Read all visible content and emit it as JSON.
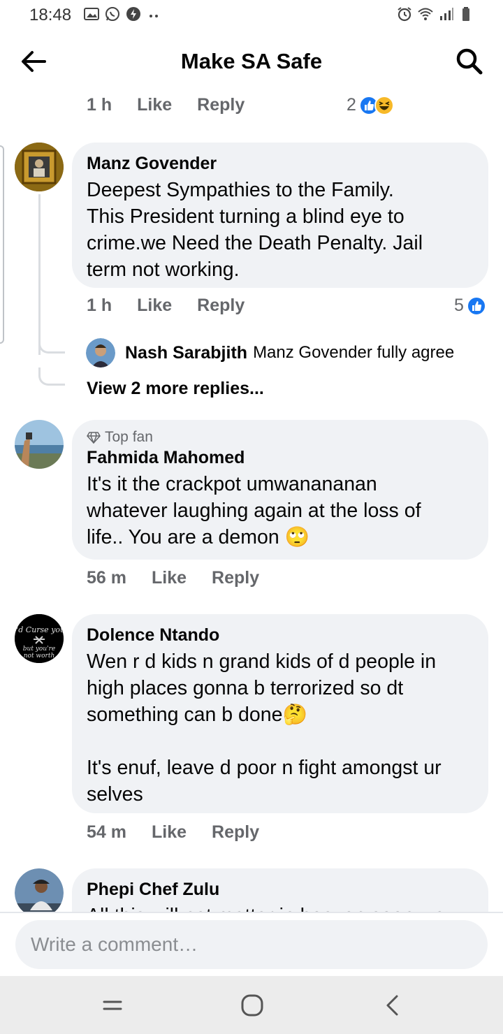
{
  "status_bar": {
    "time": "18:48",
    "left_icons": [
      "gallery-icon",
      "whatsapp-icon",
      "power-saving-icon",
      "more-dots-icon"
    ],
    "right_icons": [
      "alarm-icon",
      "wifi-icon",
      "signal-icon",
      "battery-icon"
    ]
  },
  "header": {
    "title": "Make SA Safe",
    "back_icon": "arrow-left-icon",
    "search_icon": "search-icon"
  },
  "top_meta": {
    "time": "1 h",
    "like": "Like",
    "reply": "Reply",
    "reaction_count": "2",
    "reactions": [
      "like",
      "haha"
    ]
  },
  "comments": [
    {
      "author": "Manz Govender",
      "text": "Deepest Sympathies to the Family.\nThis President turning a blind eye to\ncrime.we Need the Death Penalty. Jail\nterm not working.",
      "time": "1 h",
      "like": "Like",
      "reply": "Reply",
      "reaction_count": "5",
      "reactions": [
        "like"
      ],
      "reply_preview": {
        "author": "Nash Sarabjith",
        "text": "Manz Govender fully agree"
      },
      "view_more": "View 2 more replies..."
    },
    {
      "badge": "Top fan",
      "author": "Fahmida Mahomed",
      "text": "It's it the crackpot umwanananan\nwhatever laughing again at the loss of\nlife.. You are a demon",
      "emoji": "🙄",
      "time": "56 m",
      "like": "Like",
      "reply": "Reply"
    },
    {
      "author": "Dolence Ntando",
      "text": "Wen r d kids n grand kids of d people in\nhigh places gonna b terrorized so dt\nsomething can b done",
      "emoji": "🤔",
      "text2": "It's enuf, leave d poor n fight amongst ur\nselves",
      "time": "54 m",
      "like": "Like",
      "reply": "Reply",
      "avatar_text": "I'd Curse you but you're not worth"
    },
    {
      "author": "Phepi Chef Zulu",
      "text": "All this will not matter in heaven soon we"
    }
  ],
  "compose": {
    "placeholder": "Write a comment…"
  },
  "nav_bar": {
    "icons": [
      "recent-apps-icon",
      "home-icon",
      "back-icon"
    ]
  },
  "colors": {
    "like_blue": "#1877f2",
    "haha_yellow": "#f7b928",
    "bubble_bg": "#f0f2f5",
    "meta_gray": "#65676b"
  }
}
